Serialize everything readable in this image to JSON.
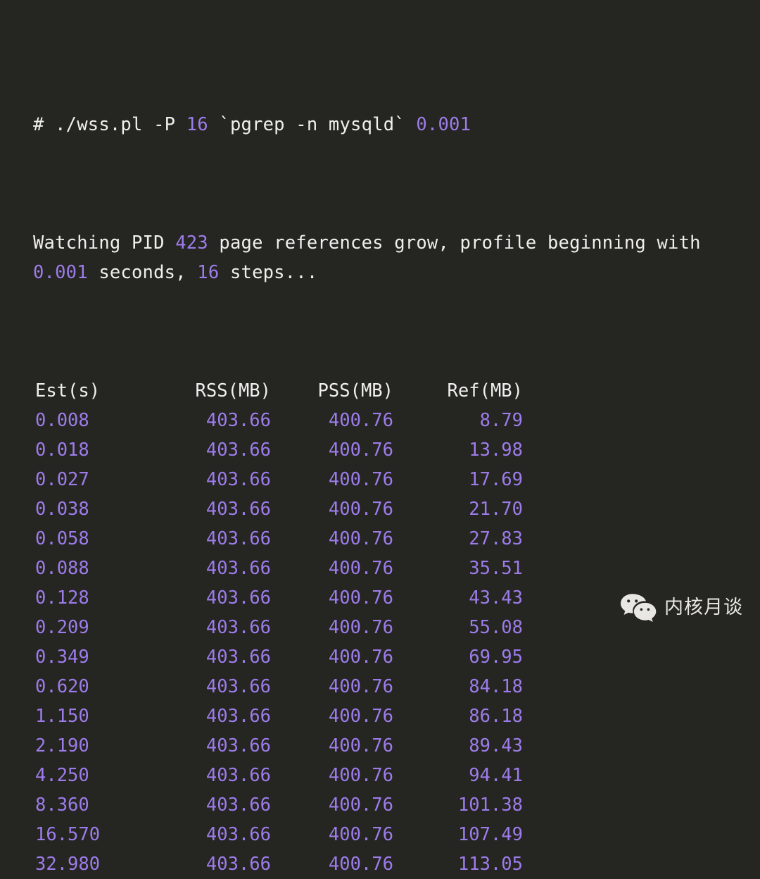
{
  "terminal": {
    "background_color": "#252522",
    "text_color": "#f0efec",
    "number_color": "#9d7cea",
    "command_line": {
      "prompt": "# ",
      "command": "./wss.pl -P ",
      "arg_parallel": "16",
      "subshell": " `pgrep -n mysqld` ",
      "arg_interval": "0.001"
    },
    "status_lines": {
      "line1_part1": "Watching PID ",
      "line1_pid": "423",
      "line1_part2": " page references grow, profile beginning with",
      "line2_duration": "0.001",
      "line2_part1": " seconds, ",
      "line2_steps": "16",
      "line2_part2": " steps..."
    },
    "table": {
      "headers": [
        "Est(s)",
        "RSS(MB)",
        "PSS(MB)",
        "Ref(MB)"
      ],
      "rows": [
        [
          "0.008",
          "403.66",
          "400.76",
          "8.79"
        ],
        [
          "0.018",
          "403.66",
          "400.76",
          "13.98"
        ],
        [
          "0.027",
          "403.66",
          "400.76",
          "17.69"
        ],
        [
          "0.038",
          "403.66",
          "400.76",
          "21.70"
        ],
        [
          "0.058",
          "403.66",
          "400.76",
          "27.83"
        ],
        [
          "0.088",
          "403.66",
          "400.76",
          "35.51"
        ],
        [
          "0.128",
          "403.66",
          "400.76",
          "43.43"
        ],
        [
          "0.209",
          "403.66",
          "400.76",
          "55.08"
        ],
        [
          "0.349",
          "403.66",
          "400.76",
          "69.95"
        ],
        [
          "0.620",
          "403.66",
          "400.76",
          "84.18"
        ],
        [
          "1.150",
          "403.66",
          "400.76",
          "86.18"
        ],
        [
          "2.190",
          "403.66",
          "400.76",
          "89.43"
        ],
        [
          "4.250",
          "403.66",
          "400.76",
          "94.41"
        ],
        [
          "8.360",
          "403.66",
          "400.76",
          "101.38"
        ],
        [
          "16.570",
          "403.66",
          "400.76",
          "107.49"
        ],
        [
          "32.980",
          "403.66",
          "400.76",
          "113.05"
        ]
      ]
    }
  },
  "watermark": {
    "icon": "wechat-logo-icon",
    "label": "内核月谈"
  }
}
